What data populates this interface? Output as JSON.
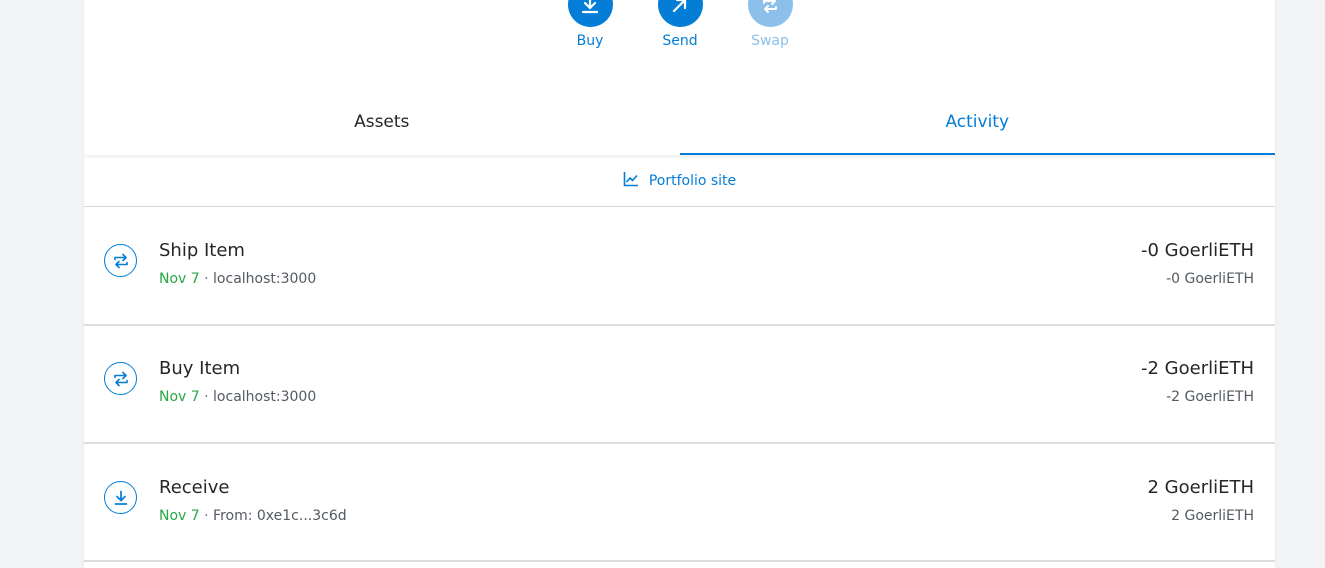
{
  "actions": [
    {
      "label": "Buy",
      "icon": "download-icon",
      "disabled": false
    },
    {
      "label": "Send",
      "icon": "arrow-up-right-icon",
      "disabled": false
    },
    {
      "label": "Swap",
      "icon": "swap-icon",
      "disabled": true
    }
  ],
  "tabs": [
    {
      "label": "Assets",
      "active": false
    },
    {
      "label": "Activity",
      "active": true
    }
  ],
  "portfolio": {
    "label": "Portfolio site",
    "icon": "chart-line-icon"
  },
  "activity": [
    {
      "title": "Ship Item",
      "date": "Nov 7",
      "separator": "·",
      "origin": "localhost:3000",
      "primary": "-0 GoerliETH",
      "secondary": "-0 GoerliETH",
      "icon": "swap-icon"
    },
    {
      "title": "Buy Item",
      "date": "Nov 7",
      "separator": "·",
      "origin": "localhost:3000",
      "primary": "-2 GoerliETH",
      "secondary": "-2 GoerliETH",
      "icon": "swap-icon"
    },
    {
      "title": "Receive",
      "date": "Nov 7",
      "separator": "·",
      "origin": "From: 0xe1c...3c6d",
      "primary": "2 GoerliETH",
      "secondary": "2 GoerliETH",
      "icon": "receive-icon"
    }
  ],
  "colors": {
    "accent": "#037dd6",
    "accent_disabled": "#8cc0ea",
    "success": "#28a745"
  }
}
